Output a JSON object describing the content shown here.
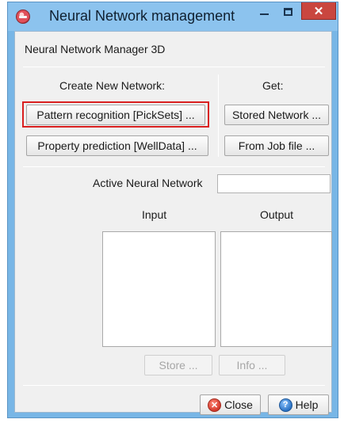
{
  "window": {
    "title": "Neural Network management",
    "close_glyph": "✕"
  },
  "header": {
    "title": "Neural Network Manager 3D"
  },
  "create": {
    "label": "Create New Network:",
    "pattern_button": "Pattern recognition [PickSets] ...",
    "property_button": "Property prediction [WellData] ..."
  },
  "get": {
    "label": "Get:",
    "stored_button": "Stored Network ...",
    "jobfile_button": "From Job file ..."
  },
  "active": {
    "label": "Active Neural Network",
    "value": ""
  },
  "lists": {
    "input_label": "Input",
    "output_label": "Output"
  },
  "actions": {
    "store_button": "Store ...",
    "info_button": "Info ..."
  },
  "footer": {
    "close_button": "Close",
    "help_button": "Help",
    "close_icon_glyph": "✕",
    "help_icon_glyph": "?"
  },
  "colors": {
    "titlebar": "#8cc3ee",
    "window_border": "#78b6e6",
    "highlight": "#d92020"
  }
}
